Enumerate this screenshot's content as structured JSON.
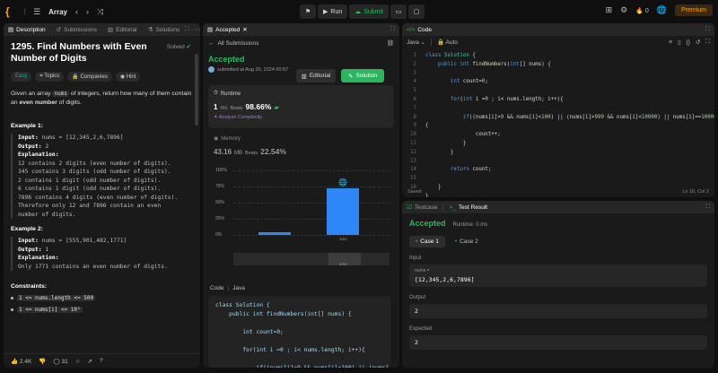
{
  "topbar": {
    "problem_list_label": "Array",
    "run_label": "Run",
    "submit_label": "Submit",
    "streak_count": "0",
    "premium_label": "Premium"
  },
  "desc": {
    "tabs": {
      "description": "Description",
      "submissions": "Submissions",
      "editorial": "Editorial",
      "solutions": "Solutions"
    },
    "title": "1295. Find Numbers with Even Number of Digits",
    "solved": "Solved",
    "tags": {
      "difficulty": "Easy",
      "topics": "Topics",
      "companies": "Companies",
      "hint": "Hint"
    },
    "para_pre": "Given an array ",
    "para_code": "nums",
    "para_mid": " of integers, return how many of them contain an ",
    "para_bold": "even number",
    "para_post": " of digits.",
    "ex1": {
      "title": "Example 1:",
      "input_label": "Input:",
      "input": " nums = [12,345,2,6,7896]",
      "output_label": "Output:",
      "output": " 2",
      "expl_label": "Explanation:",
      "lines": [
        "12 contains 2 digits (even number of digits).",
        "345 contains 3 digits (odd number of digits).",
        "2 contains 1 digit (odd number of digits).",
        "6 contains 1 digit (odd number of digits).",
        "7896 contains 4 digits (even number of digits).",
        "Therefore only 12 and 7896 contain an even",
        "number of digits."
      ]
    },
    "ex2": {
      "title": "Example 2:",
      "input_label": "Input:",
      "input": " nums = [555,901,482,1771]",
      "output_label": "Output:",
      "output": " 1",
      "expl_label": "Explanation:",
      "lines": [
        "Only 1771 contains an even number of digits."
      ]
    },
    "constraints_title": "Constraints:",
    "constraints": [
      "1 <= nums.length <= 500",
      "1 <= nums[i] <= 10⁵"
    ],
    "footer": {
      "likes": "2.4K",
      "comments": "31"
    }
  },
  "accepted": {
    "tab": "Accepted",
    "back": "All Submissions",
    "status": "Accepted",
    "submitted": "submitted at Aug 20, 2024 00:57",
    "editorial": "Editorial",
    "solution": "Solution",
    "runtime": {
      "label": "Runtime",
      "value": "1",
      "unit": "ms",
      "beats": "Beats",
      "pct": "98.66%",
      "analyze": "Analyze Complexity"
    },
    "memory": {
      "label": "Memory",
      "value": "43.16",
      "unit": "MB",
      "beats": "Beats",
      "pct": "22.54%"
    },
    "chart": {
      "yticks": [
        "100%",
        "75%",
        "50%",
        "25%",
        "0%"
      ],
      "bar_label": "1ms",
      "mini_label": "1ms"
    },
    "code_label": "Code",
    "code_lang": "Java",
    "code_lines": [
      "class Solution {",
      "    public int findNumbers(int[] nums) {",
      "",
      "        int count=0;",
      "",
      "        for(int i =0 ; i< nums.length; i++){",
      "",
      "            if((nums[i]>9 && nums[i]<100) || (nums["
    ]
  },
  "chart_data": {
    "type": "bar",
    "categories": [
      "",
      "1ms"
    ],
    "values": [
      4,
      72
    ],
    "ylim": [
      0,
      100
    ],
    "yticks": [
      "100%",
      "75%",
      "50%",
      "25%",
      "0%"
    ]
  },
  "editor": {
    "tab": "Code",
    "lang": "Java",
    "mode": "Auto",
    "status": "Saved",
    "position": "Ln 16, Col 2",
    "line_numbers": [
      "1",
      "2",
      "3",
      "4",
      "5",
      "6",
      "7",
      "8",
      "9",
      "10",
      "11",
      "12",
      "13",
      "14",
      "15",
      "16"
    ]
  },
  "testresult": {
    "tab_testcase": "Testcase",
    "tab_result": "Test Result",
    "status": "Accepted",
    "runtime": "Runtime: 0 ms",
    "case1": "Case 1",
    "case2": "Case 2",
    "input_label": "Input",
    "input_sub": "nums =",
    "input_val": "[12,345,2,6,7896]",
    "output_label": "Output",
    "output_val": "2",
    "expected_label": "Expected",
    "expected_val": "2"
  }
}
